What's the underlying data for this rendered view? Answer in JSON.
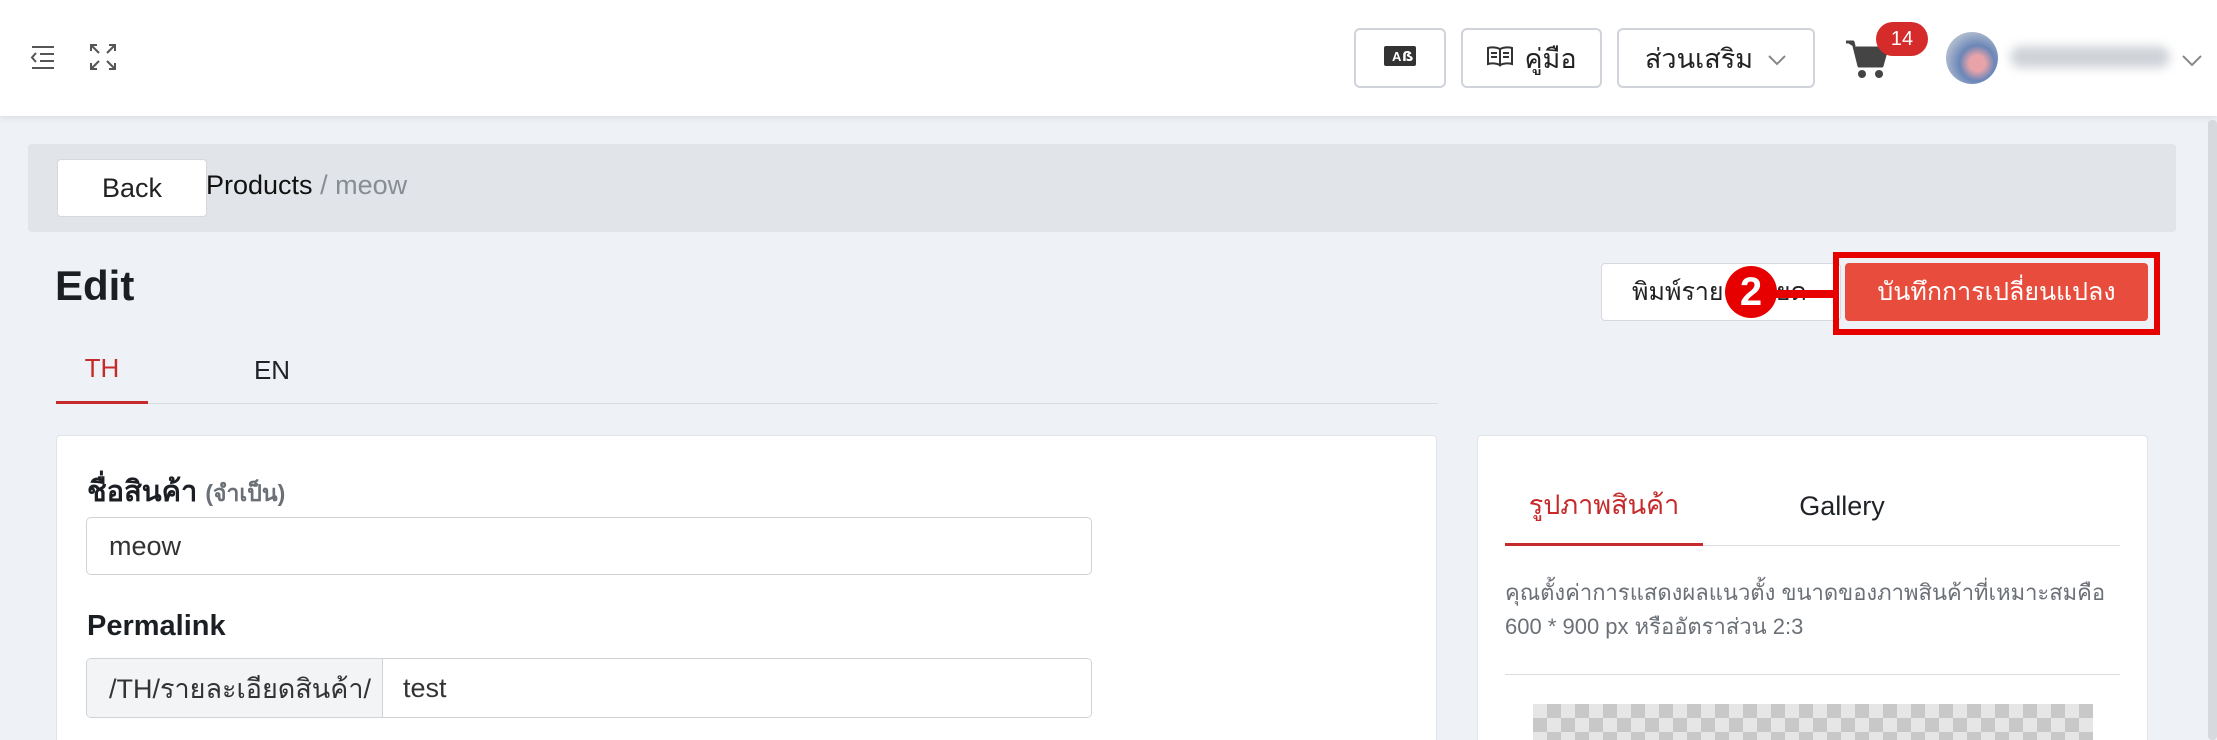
{
  "header": {
    "translate_icon": "translate-icon",
    "manual_label": "คู่มือ",
    "addons_label": "ส่วนเสริม",
    "cart_count": "14"
  },
  "breadcrumb": {
    "back_label": "Back",
    "parent": "Products",
    "separator": "/",
    "current": "meow"
  },
  "page": {
    "title": "Edit",
    "print_label": "พิมพ์รายละเอียด",
    "save_label": "บันทึกการเปลี่ยนแปลง",
    "step_marker": "2"
  },
  "lang_tabs": [
    {
      "label": "TH",
      "active": true
    },
    {
      "label": "EN",
      "active": false
    }
  ],
  "form": {
    "name_label": "ชื่อสินค้า",
    "name_required": "(จำเป็น)",
    "name_value": "meow",
    "permalink_label": "Permalink",
    "permalink_prefix": "/TH/รายละเอียดสินค้า/",
    "permalink_value": "test"
  },
  "image_panel": {
    "tabs": [
      {
        "label": "รูปภาพสินค้า",
        "active": true
      },
      {
        "label": "Gallery",
        "active": false
      }
    ],
    "hint": "คุณตั้งค่าการแสดงผลแนวตั้ง ขนาดของภาพสินค้าที่เหมาะสมคือ 600 * 900 px หรืออัตราส่วน 2:3"
  },
  "colors": {
    "accent": "#c62a2a",
    "save_button": "#e84c3d",
    "highlight": "#e60000",
    "badge": "#d52b2b"
  }
}
